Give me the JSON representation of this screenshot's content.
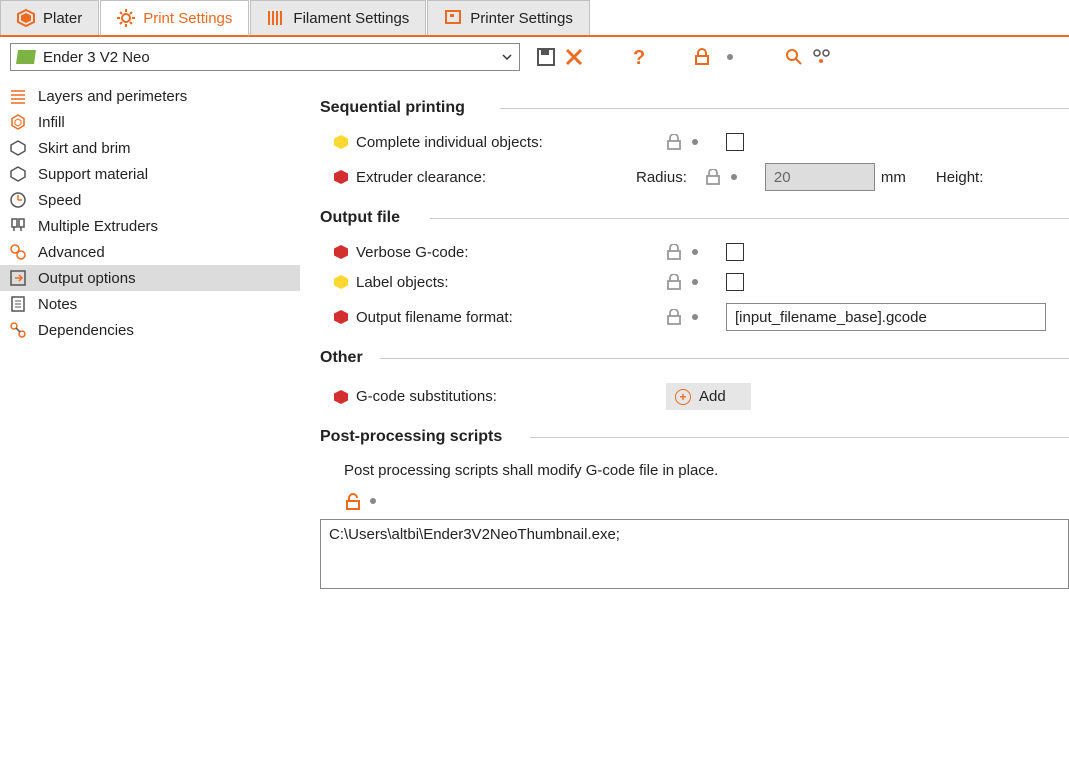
{
  "tabs": {
    "plater": "Plater",
    "print": "Print Settings",
    "filament": "Filament Settings",
    "printer": "Printer Settings"
  },
  "preset": {
    "name": "Ender 3 V2 Neo"
  },
  "sidebar": {
    "items": [
      "Layers and perimeters",
      "Infill",
      "Skirt and brim",
      "Support material",
      "Speed",
      "Multiple Extruders",
      "Advanced",
      "Output options",
      "Notes",
      "Dependencies"
    ]
  },
  "sections": {
    "seq": {
      "title": "Sequential printing",
      "complete": "Complete individual objects:",
      "clearance": "Extruder clearance:",
      "radius_label": "Radius:",
      "radius_value": "20",
      "radius_unit": "mm",
      "height_label": "Height:"
    },
    "output": {
      "title": "Output file",
      "verbose": "Verbose G-code:",
      "label_obj": "Label objects:",
      "fname": "Output filename format:",
      "fname_value": "[input_filename_base].gcode"
    },
    "other": {
      "title": "Other",
      "subs": "G-code substitutions:",
      "add": "Add"
    },
    "pp": {
      "title": "Post-processing scripts",
      "hint": "Post processing scripts shall modify G-code file in place.",
      "value": "C:\\Users\\altbi\\Ender3V2NeoThumbnail.exe;"
    }
  }
}
